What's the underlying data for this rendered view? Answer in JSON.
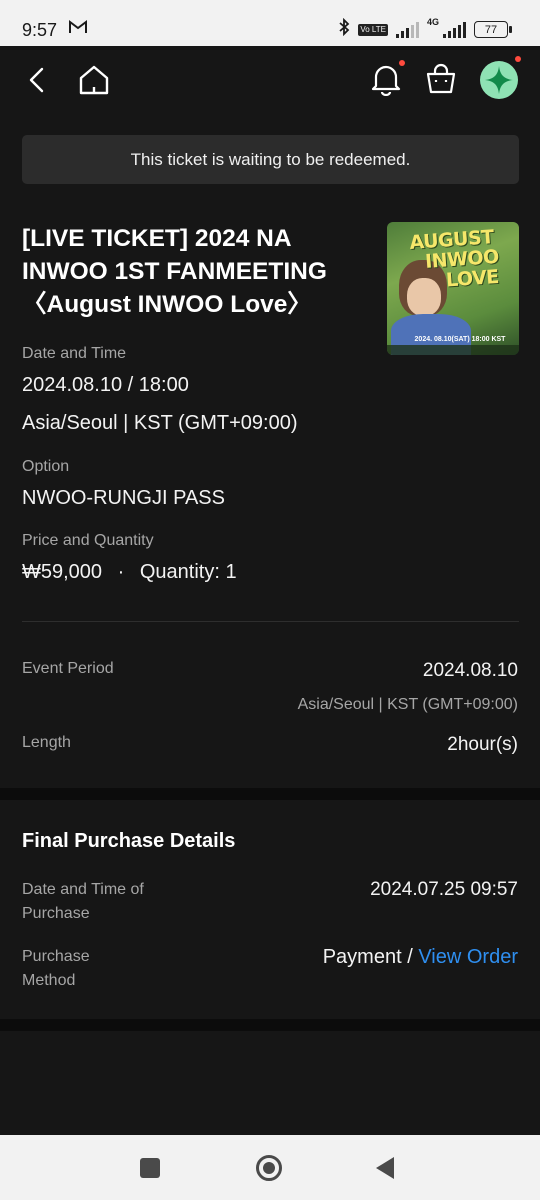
{
  "status_bar": {
    "time": "9:57",
    "volte": "Vo LTE",
    "network": "4G",
    "battery": "77"
  },
  "header": {
    "icons": [
      "back-arrow-icon",
      "home-icon",
      "bell-icon",
      "shopping-bag-icon",
      "avatar"
    ]
  },
  "banner": {
    "text": "This ticket is waiting to be redeemed."
  },
  "ticket": {
    "title": "[LIVE TICKET] 2024 NA INWOO 1ST FANMEETING 〈August INWOO Love〉",
    "poster": {
      "title_line1": "AUGUST",
      "title_line2": "INWOO",
      "title_line3": "LOVE",
      "date_text": "2024. 08.10(SAT) 18:00 KST"
    },
    "date_time_label": "Date and Time",
    "date_time": "2024.08.10 / 18:00",
    "timezone": "Asia/Seoul | KST (GMT+09:00)",
    "option_label": "Option",
    "option": "NWOO-RUNGJI PASS",
    "price_label": "Price and Quantity",
    "price": "₩59,000",
    "separator": "·",
    "quantity": "Quantity: 1"
  },
  "event": {
    "period_label": "Event Period",
    "period": "2024.08.10",
    "period_timezone": "Asia/Seoul | KST (GMT+09:00)",
    "length_label": "Length",
    "length": "2hour(s)"
  },
  "purchase": {
    "section_title": "Final Purchase Details",
    "date_label_line1": "Date and Time of",
    "date_label_line2": "Purchase",
    "date": "2024.07.25 09:57",
    "method_label_line1": "Purchase",
    "method_label_line2": "Method",
    "method": "Payment /",
    "view_order": "View Order"
  },
  "colors": {
    "background": "#161616",
    "banner": "#2c2c2c",
    "link": "#2f8ff0",
    "avatar": "#8fe2b4",
    "notification_dot": "#ff4b3e"
  }
}
